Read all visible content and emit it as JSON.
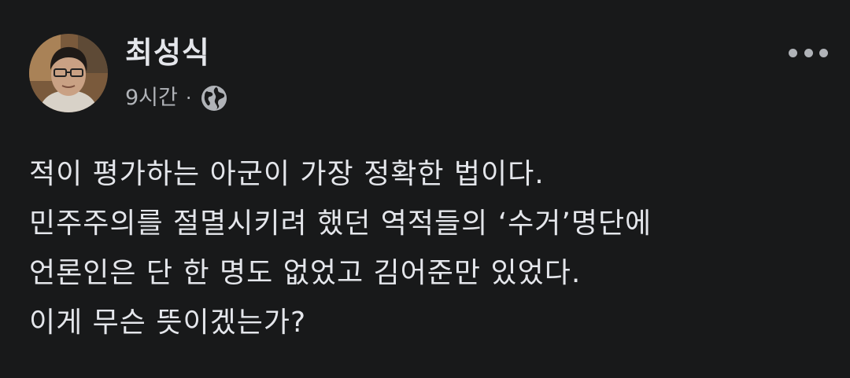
{
  "post": {
    "author": "최성식",
    "time": "9시간",
    "separator": "·",
    "privacy_icon": "globe-icon",
    "more_icon": "more-horizontal-icon",
    "lines": [
      "적이 평가하는 아군이 가장 정확한 법이다.",
      "민주주의를 절멸시키려 했던 역적들의 ‘수거’명단에",
      "언론인은 단 한 명도 없었고 김어준만 있었다.",
      "이게 무슨 뜻이겠는가?"
    ]
  },
  "colors": {
    "background": "#18191a",
    "primary_text": "#e4e6eb",
    "secondary_text": "#b0b3b8"
  }
}
